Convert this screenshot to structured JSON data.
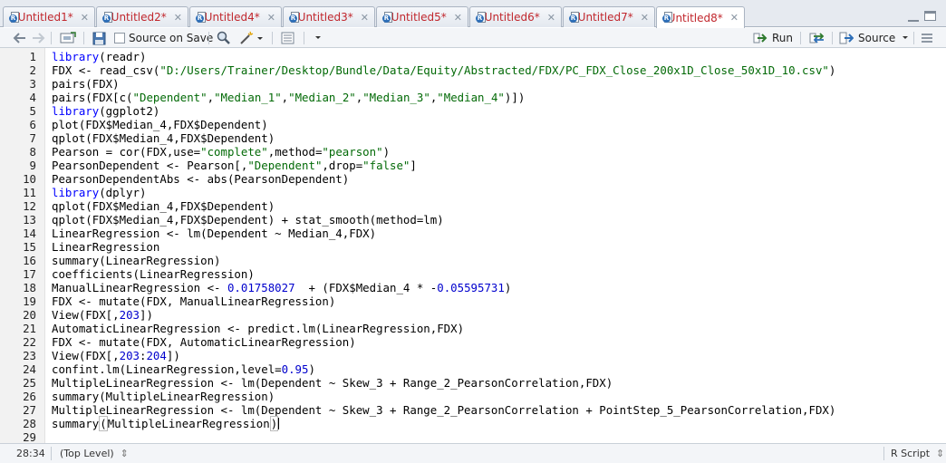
{
  "tabs": [
    {
      "label": "Untitled1*"
    },
    {
      "label": "Untitled2*"
    },
    {
      "label": "Untitled4*"
    },
    {
      "label": "Untitled3*"
    },
    {
      "label": "Untitled5*"
    },
    {
      "label": "Untitled6*"
    },
    {
      "label": "Untitled7*"
    },
    {
      "label": "Untitled8*"
    }
  ],
  "toolbar": {
    "source_on_save_label": "Source on Save",
    "run_label": "Run",
    "source_label": "Source"
  },
  "editor": {
    "lines": [
      "library(readr)",
      "FDX <- read_csv(\"D:/Users/Trainer/Desktop/Bundle/Data/Equity/Abstracted/FDX/PC_FDX_Close_200x1D_Close_50x1D_10.csv\")",
      "pairs(FDX)",
      "pairs(FDX[c(\"Dependent\",\"Median_1\",\"Median_2\",\"Median_3\",\"Median_4\")])",
      "library(ggplot2)",
      "plot(FDX$Median_4,FDX$Dependent)",
      "qplot(FDX$Median_4,FDX$Dependent)",
      "Pearson = cor(FDX,use=\"complete\",method=\"pearson\")",
      "PearsonDependent <- Pearson[,\"Dependent\",drop=\"false\"]",
      "PearsonDependentAbs <- abs(PearsonDependent)",
      "library(dplyr)",
      "qplot(FDX$Median_4,FDX$Dependent)",
      "qplot(FDX$Median_4,FDX$Dependent) + stat_smooth(method=lm)",
      "LinearRegression <- lm(Dependent ~ Median_4,FDX)",
      "LinearRegression",
      "summary(LinearRegression)",
      "coefficients(LinearRegression)",
      "ManualLinearRegression <- 0.01758027  + (FDX$Median_4 * -0.05595731)",
      "FDX <- mutate(FDX, ManualLinearRegression)",
      "View(FDX[,203])",
      "AutomaticLinearRegression <- predict.lm(LinearRegression,FDX)",
      "FDX <- mutate(FDX, AutomaticLinearRegression)",
      "View(FDX[,203:204])",
      "confint.lm(LinearRegression,level=0.95)",
      "MultipleLinearRegression <- lm(Dependent ~ Skew_3 + Range_2_PearsonCorrelation,FDX)",
      "summary(MultipleLinearRegression)",
      "MultipleLinearRegression <- lm(Dependent ~ Skew_3 + Range_2_PearsonCorrelation + PointStep_5_PearsonCorrelation,FDX)",
      "summary(MultipleLinearRegression)",
      ""
    ]
  },
  "status": {
    "position": "28:34",
    "scope": "(Top Level)",
    "file_type": "R Script"
  }
}
